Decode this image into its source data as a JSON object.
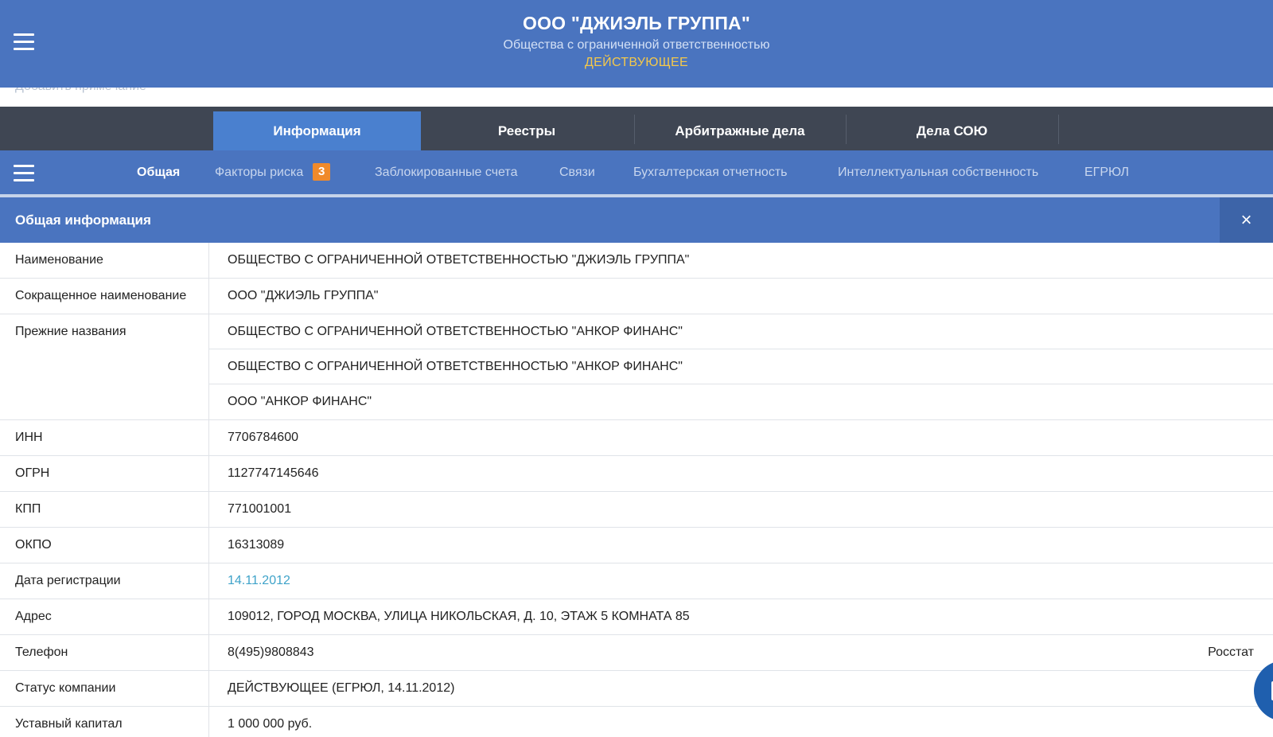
{
  "header": {
    "title": "ООО \"ДЖИЭЛЬ ГРУППА\"",
    "subtitle": "Общества с ограниченной ответственностью",
    "status": "ДЕЙСТВУЮЩЕЕ",
    "note_link": "Добавить примечание"
  },
  "tabs": [
    {
      "label": "Информация",
      "active": true
    },
    {
      "label": "Реестры"
    },
    {
      "label": "Арбитражные дела"
    },
    {
      "label": "Дела СОЮ"
    }
  ],
  "subnav": {
    "items": [
      {
        "label": "Общая",
        "active": true
      },
      {
        "label": "Факторы риска",
        "badge": "3"
      },
      {
        "label": "Заблокированные счета"
      },
      {
        "label": "Связи"
      },
      {
        "label": "Бухгалтерская отчетность"
      },
      {
        "label": "Интеллектуальная собственность"
      },
      {
        "label": "ЕГРЮЛ"
      }
    ]
  },
  "section": {
    "title": "Общая информация",
    "close_icon": "×"
  },
  "rows": [
    {
      "label": "Наименование",
      "values": [
        "ОБЩЕСТВО С ОГРАНИЧЕННОЙ ОТВЕТСТВЕННОСТЬЮ \"ДЖИЭЛЬ ГРУППА\""
      ]
    },
    {
      "label": "Сокращенное наименование",
      "values": [
        "ООО \"ДЖИЭЛЬ ГРУППА\""
      ]
    },
    {
      "label": "Прежние названия",
      "values": [
        "ОБЩЕСТВО С ОГРАНИЧЕННОЙ ОТВЕТСТВЕННОСТЬЮ \"АНКОР ФИНАНС\"",
        "ОБЩЕСТВО С ОГРАНИЧЕННОЙ ОТВЕТСТВЕННОСТЬЮ \"АНКОР ФИНАНС\"",
        "ООО \"АНКОР ФИНАНС\""
      ]
    },
    {
      "label": "ИНН",
      "values": [
        "7706784600"
      ]
    },
    {
      "label": "ОГРН",
      "values": [
        "1127747145646"
      ]
    },
    {
      "label": "КПП",
      "values": [
        "771001001"
      ]
    },
    {
      "label": "ОКПО",
      "values": [
        "16313089"
      ]
    },
    {
      "label": "Дата регистрации",
      "values": [
        "14.11.2012"
      ]
    },
    {
      "label": "Адрес",
      "values": [
        "109012, ГОРОД МОСКВА, УЛИЦА НИКОЛЬСКАЯ, Д. 10, ЭТАЖ 5 КОМНАТА 85"
      ]
    },
    {
      "label": "Телефон",
      "values": [
        "8(495)9808843"
      ],
      "side": "Росстат"
    },
    {
      "label": "Статус компании",
      "values": [
        "ДЕЙСТВУЮЩЕЕ (ЕГРЮЛ, 14.11.2012)"
      ]
    },
    {
      "label": "Уставный капитал",
      "values": [
        "1 000 000 руб."
      ]
    }
  ],
  "colors": {
    "header_blue": "#4a74bf",
    "tab_bar_dark": "#3f4653",
    "active_tab": "#4a80cf",
    "status_yellow": "#f4c84a",
    "badge_orange": "#f08a2b",
    "link_blue": "#3fa3c9"
  },
  "icons": {
    "menu": "hamburger-menu-icon",
    "close": "close-icon",
    "chat": "chat-icon"
  }
}
